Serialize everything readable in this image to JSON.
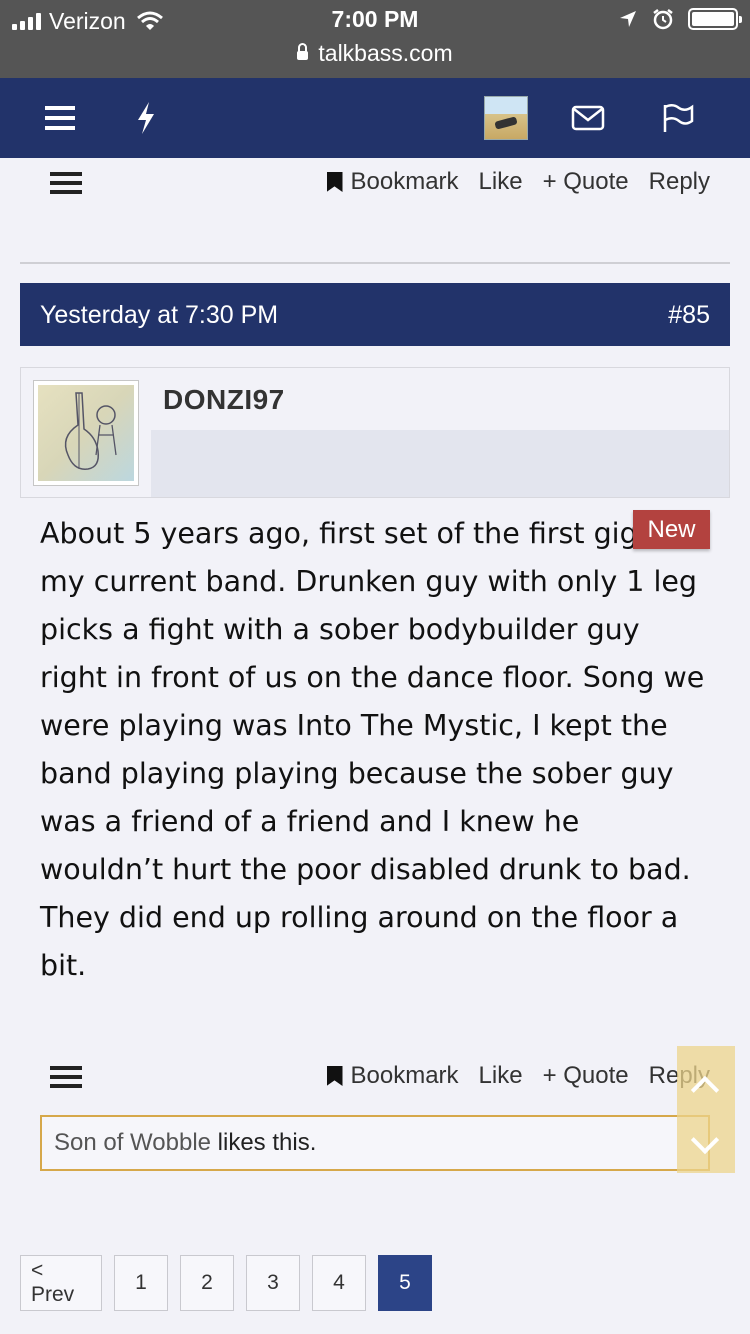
{
  "status_bar": {
    "carrier": "Verizon",
    "time": "7:00 PM",
    "url": "talkbass.com"
  },
  "navbar": {
    "icons": [
      "menu-icon",
      "lightning-icon",
      "user-avatar",
      "mail-icon",
      "flag-icon"
    ]
  },
  "top_actions": {
    "bookmark": "Bookmark",
    "like": "Like",
    "quote": "+ Quote",
    "reply": "Reply"
  },
  "post": {
    "date": "Yesterday at 7:30 PM",
    "number": "#85",
    "username": "DONZI97",
    "badge": "New",
    "body": "About 5 years ago, first set of the first gig with my current band. Drunken guy with only 1 leg picks a fight with a sober bodybuilder guy right in front of us on the dance floor. Song we were playing was Into The Mystic, I kept the band playing playing because the sober guy was a friend of a friend and I knew he wouldn’t hurt the poor disabled drunk to bad. They did end up rolling around on the floor a bit.",
    "actions": {
      "bookmark": "Bookmark",
      "like": "Like",
      "quote": "+ Quote",
      "reply": "Reply"
    },
    "likes": {
      "user": "Son of Wobble",
      "text": " likes this."
    }
  },
  "pagination": {
    "prev": "< Prev",
    "pages": [
      "1",
      "2",
      "3",
      "4",
      "5"
    ],
    "current": "5"
  },
  "colors": {
    "nav_bg": "#22336a",
    "badge_bg": "#b3423f",
    "likes_border": "#d6a84a",
    "active_page": "#2c4487"
  }
}
